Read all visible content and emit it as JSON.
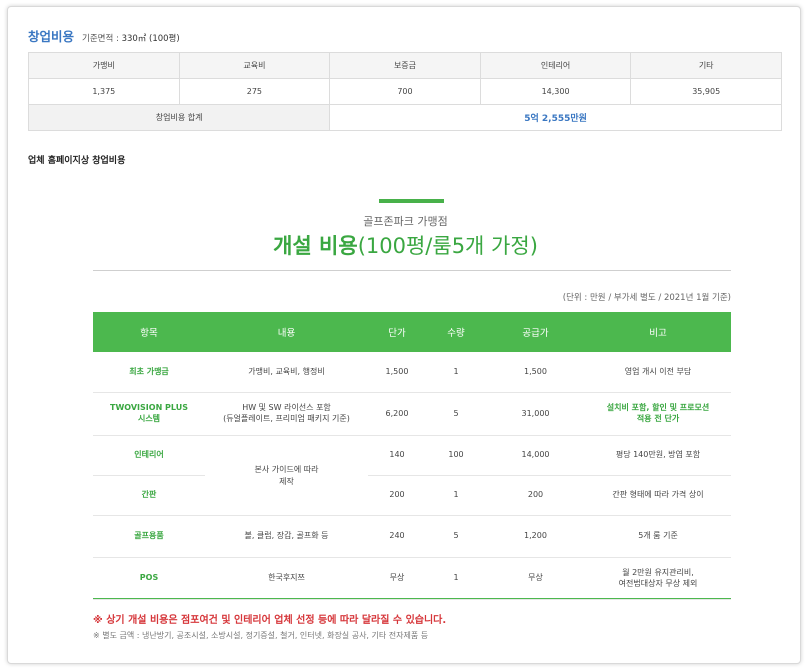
{
  "header": {
    "title": "창업비용",
    "area_label": "기준면적 :",
    "area_value": "330㎡ (100평)"
  },
  "summary": {
    "headers": [
      "가맹비",
      "교육비",
      "보증금",
      "인테리어",
      "기타"
    ],
    "values": [
      "1,375",
      "275",
      "700",
      "14,300",
      "35,905"
    ],
    "total_label": "창업비용 합계",
    "total_value": "5억 2,555만원"
  },
  "section_title": "업체 홈페이지상 창업비용",
  "poster": {
    "subtitle": "골프존파크 가맹점",
    "title_bold": "개설 비용",
    "title_light": "(100평/룸5개 가정)",
    "unit_note": "(단위 : 만원 / 부가세 별도 / 2021년 1월 기준)",
    "columns": [
      "항목",
      "내용",
      "단가",
      "수량",
      "공급가",
      "비고"
    ],
    "rows": [
      {
        "item": "최초 가맹금",
        "content": "가맹비, 교육비, 행정비",
        "price": "1,500",
        "qty": "1",
        "supply": "1,500",
        "note": "영업 개시 이전 부담"
      },
      {
        "item": "TWOVISION PLUS\n시스템",
        "content": "HW 및 SW 라이선스 포함\n(듀얼플레이트, 프리미엄 패키지 기준)",
        "price": "6,200",
        "qty": "5",
        "supply": "31,000",
        "note": "설치비 포함, 할인 및 프로모션\n적용 전 단가"
      },
      {
        "item": "인테리어",
        "content": "",
        "price": "140",
        "qty": "100",
        "supply": "14,000",
        "note": "평당 140만원, 방염 포함"
      },
      {
        "item": "간판",
        "content": "",
        "price": "200",
        "qty": "1",
        "supply": "200",
        "note": "간판 형태에 따라 가격 상이"
      },
      {
        "item": "골프용품",
        "content": "볼, 클럽, 장갑, 골프화 등",
        "price": "240",
        "qty": "5",
        "supply": "1,200",
        "note": "5개 룸 기준"
      },
      {
        "item": "POS",
        "content": "한국후지쯔",
        "price": "무상",
        "qty": "1",
        "supply": "무상",
        "note": "월 2만원 유지관리비,\n여전법대상자 무상 제외"
      }
    ],
    "merged_content": "본사 가이드에 따라\n제작",
    "note_red": "※ 상기 개설 비용은 점포여건 및 인테리어 업체 선정 등에 따라 달라질 수 있습니다.",
    "note_gray": "※ 별도 금액 : 냉난방기, 공조시설, 소방시설, 정기증설, 철거, 인터넷, 화장실 공사, 기타 전자제품 등"
  },
  "colors": {
    "accent_blue": "#3a77c2",
    "accent_green": "#4cb84e",
    "note_red": "#d6363a"
  }
}
